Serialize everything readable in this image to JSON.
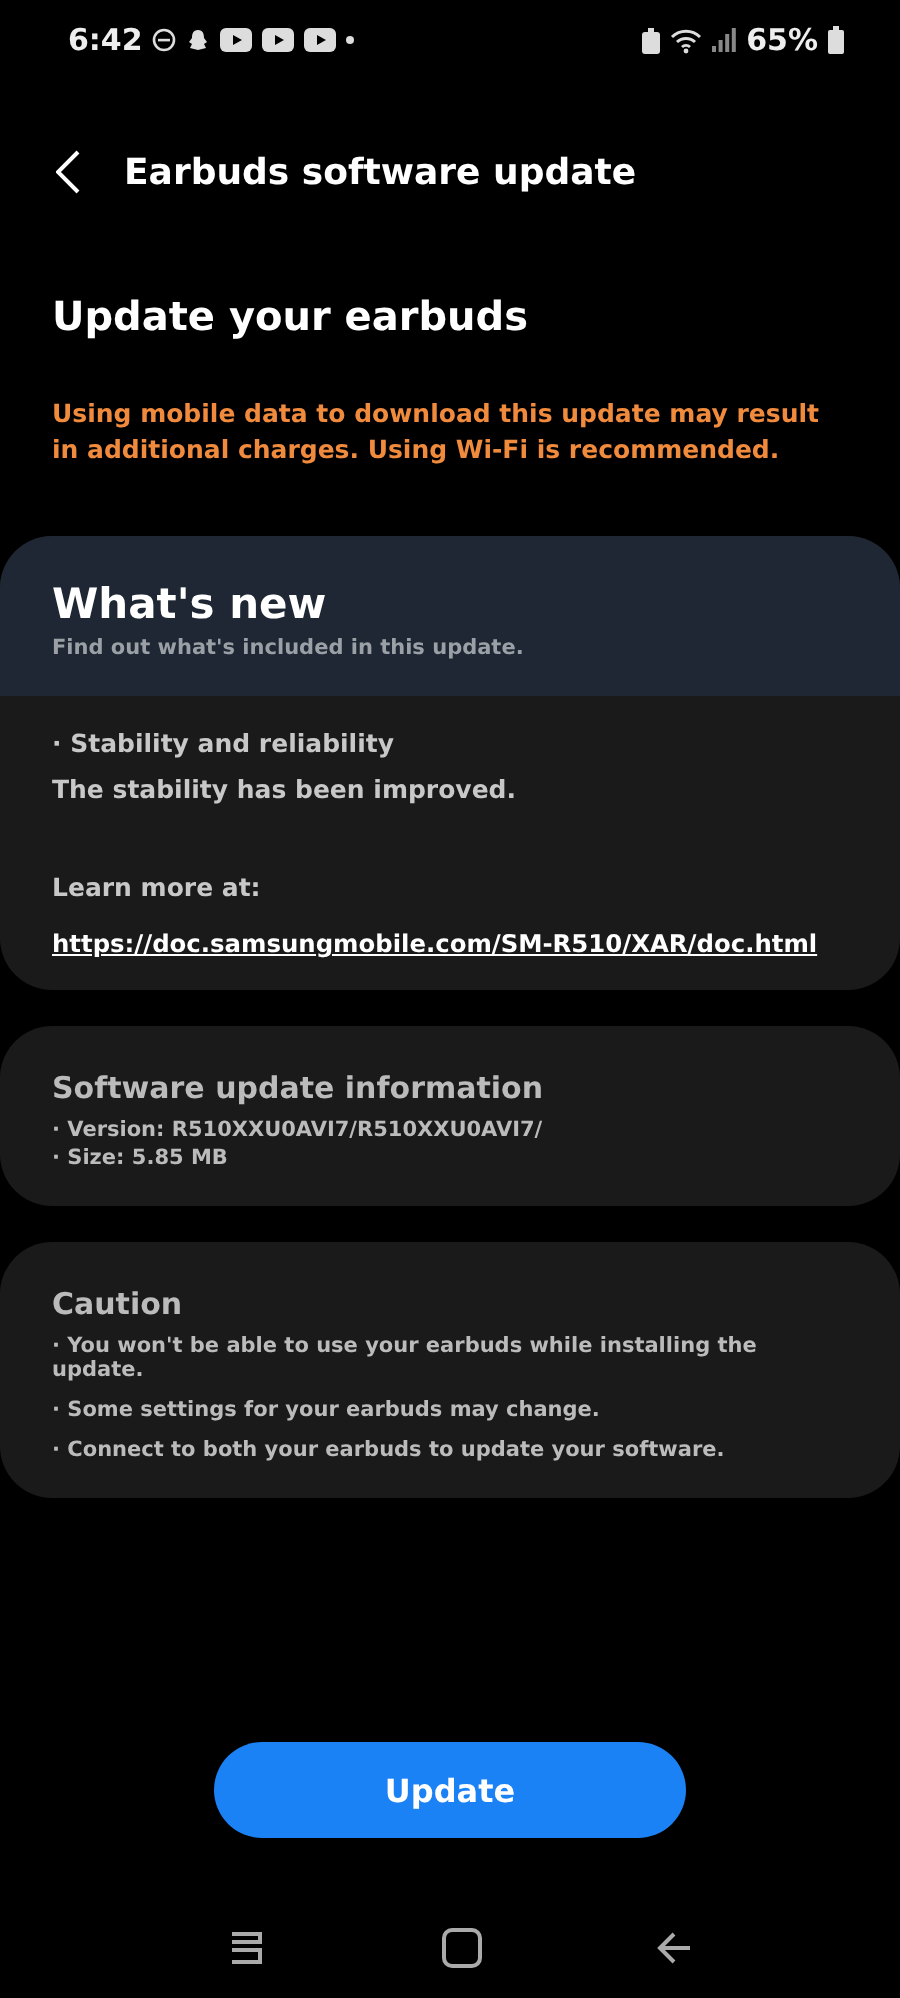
{
  "status_bar": {
    "time": "6:42",
    "battery": "65%"
  },
  "header": {
    "title": "Earbuds software update"
  },
  "heading": "Update your earbuds",
  "warning": "Using mobile data to download this update may result in additional charges. Using Wi-Fi is recommended.",
  "whats_new": {
    "title": "What's new",
    "subtitle": "Find out what's included in this update.",
    "item": "· Stability and reliability",
    "description": "The stability has been improved.",
    "learn_more": "Learn more at:",
    "link": "https://doc.samsungmobile.com/SM-R510/XAR/doc.html"
  },
  "info": {
    "title": "Software update information",
    "lines": [
      "· Version: R510XXU0AVI7/R510XXU0AVI7/",
      "· Size: 5.85 MB"
    ]
  },
  "caution": {
    "title": "Caution",
    "lines": [
      "· You won't be able to use your earbuds while installing the update.",
      "· Some settings for your earbuds may change.",
      "· Connect to both your earbuds to update your software."
    ]
  },
  "button": "Update"
}
